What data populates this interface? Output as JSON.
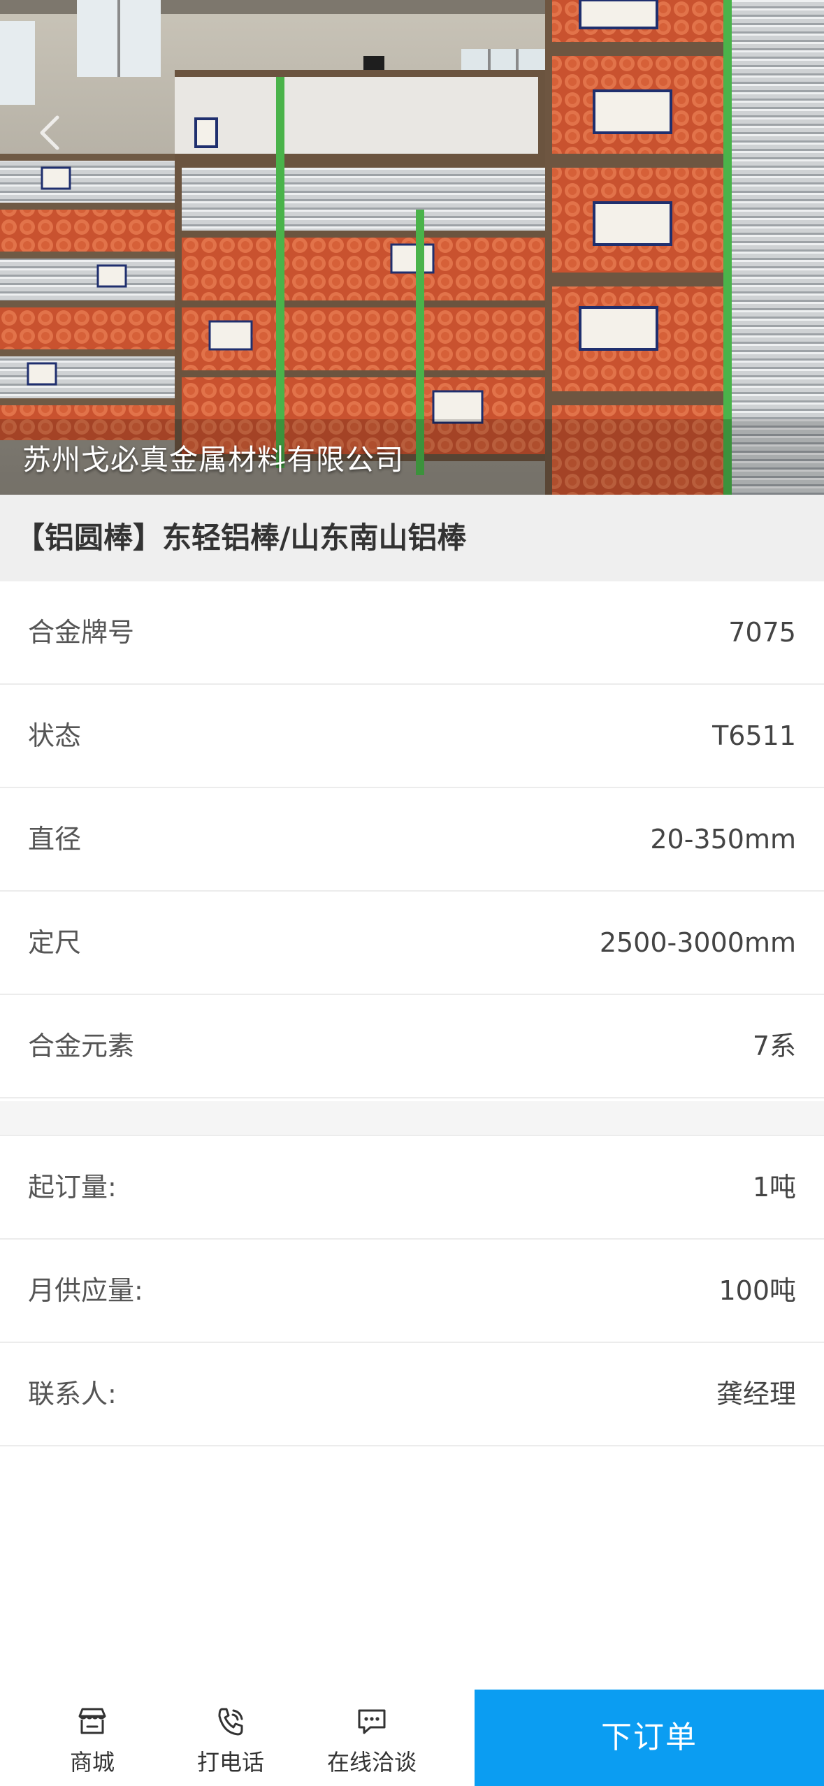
{
  "hero": {
    "company_name": "苏州戈必真金属材料有限公司"
  },
  "product": {
    "title": "【铝圆棒】东轻铝棒/山东南山铝棒"
  },
  "specs": [
    {
      "label": "合金牌号",
      "value": "7075"
    },
    {
      "label": "状态",
      "value": "T6511"
    },
    {
      "label": "直径",
      "value": "20-350mm"
    },
    {
      "label": "定尺",
      "value": "2500-3000mm"
    },
    {
      "label": "合金元素",
      "value": "7系"
    }
  ],
  "supply": [
    {
      "label": "起订量:",
      "value": "1吨"
    },
    {
      "label": "月供应量:",
      "value": "100吨"
    },
    {
      "label": "联系人:",
      "value": "龚经理"
    }
  ],
  "bottom_bar": {
    "shop": {
      "label": "商城",
      "icon": "store-icon"
    },
    "call": {
      "label": "打电话",
      "icon": "phone-icon"
    },
    "chat": {
      "label": "在线洽谈",
      "icon": "chat-icon"
    },
    "order_label": "下订单"
  },
  "colors": {
    "accent": "#0b9df2",
    "title_band": "#efefef",
    "divider": "#ececec"
  }
}
